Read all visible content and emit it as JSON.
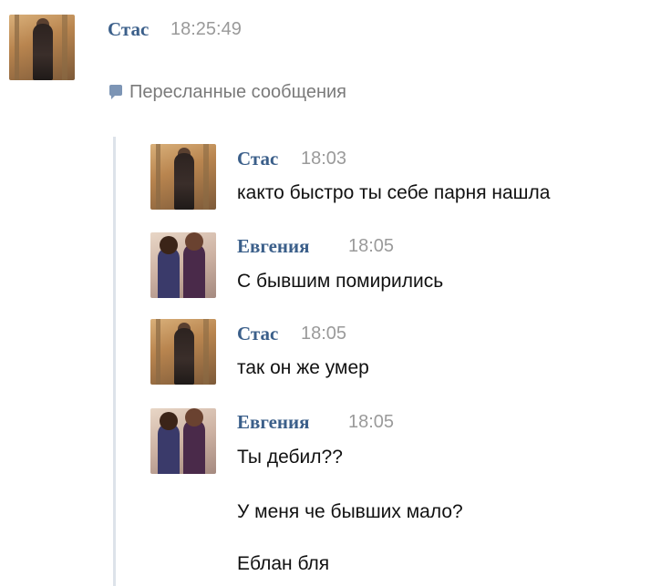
{
  "top_message": {
    "author": "Стас",
    "time": "18:25:49"
  },
  "forwarded_label": "Пересланные сообщения",
  "messages": [
    {
      "author": "Стас",
      "time": "18:03",
      "text": "както быстро ты себе парня нашла"
    },
    {
      "author": "Евгения",
      "time": "18:05",
      "text": "С бывшим помирились"
    },
    {
      "author": "Стас",
      "time": "18:05",
      "text": "так он же умер"
    },
    {
      "author": "Евгения",
      "time": "18:05",
      "lines": [
        "Ты дебил??",
        "У меня че бывших мало?",
        "Еблан бля"
      ]
    }
  ],
  "icons": {
    "forward": "speech-bubble-icon"
  },
  "colors": {
    "name": "#3b5f8a",
    "time": "#9a9a9a",
    "quote_line": "#dde3ea"
  }
}
